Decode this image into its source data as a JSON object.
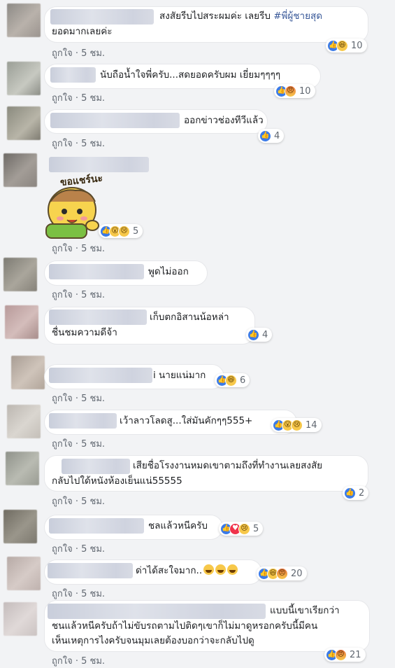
{
  "actions": {
    "like": "ถูกใจ",
    "sep": " · "
  },
  "comments": [
    {
      "text_lines": [
        "สงสัยรีบไปสระผมค่ะ เลยรีบ ",
        "ยอดมากเลยค่ะ"
      ],
      "hashtag": "#พี่ผู้ชายสุด",
      "time": "5 ชม.",
      "reactions": [
        "like",
        "haha"
      ],
      "count": "10"
    },
    {
      "text_lines": [
        "นับถือน้ำใจพี่ครับ...สดยอดครับผม เยี่ยมๆๆๆๆ"
      ],
      "time": "5 ชม.",
      "reactions": [
        "like",
        "angry"
      ],
      "count": "10"
    },
    {
      "text_lines": [
        "ออกข่าวช่องทีวีแล้ว"
      ],
      "time": "5 ชม.",
      "reactions": [
        "like"
      ],
      "count": "4"
    },
    {
      "sticker_text": "ขอแชร์นะ",
      "time": "5 ชม.",
      "reactions": [
        "like",
        "wow",
        "sad"
      ],
      "count": "5"
    },
    {
      "text_lines": [
        "พูดไม่ออก"
      ],
      "time": "5 ชม."
    },
    {
      "text_lines": [
        "เก็บตกอิสานน้อหล่า",
        "ชื่นชมความดีจ้า"
      ],
      "reactions": [
        "like"
      ],
      "count": "4"
    },
    {
      "text_lines": [
        "i นายแน่มาก"
      ],
      "time": "5 ชม.",
      "reactions": [
        "like",
        "haha"
      ],
      "count": "6"
    },
    {
      "text_lines": [
        "เว้าลาวโลดสู...ใส่มันคักๆๆ555+"
      ],
      "time": "5 ชม.",
      "reactions": [
        "like",
        "wow",
        "sad"
      ],
      "count": "14"
    },
    {
      "text_lines": [
        "เสียชื่อโรงงานหมดเขาตามถึงที่ทำงานเลยสงสัย",
        "กลับไปใด้หนังห้องเย็นแน่55555"
      ],
      "time": "5 ชม.",
      "reactions": [
        "like"
      ],
      "count": "2"
    },
    {
      "text_lines": [
        "ชลแล้วหนีครับ"
      ],
      "time": "5 ชม.",
      "reactions": [
        "like",
        "love",
        "sad"
      ],
      "count": "5"
    },
    {
      "text_lines": [
        "ด่าได้สะใจมาก.."
      ],
      "time": "5 ชม.",
      "reactions": [
        "like",
        "haha",
        "angry"
      ],
      "count": "20"
    },
    {
      "text_lines": [
        "แบบนี้เขาเรียกว่า",
        "ชนแล้วหนีครับถ้าไม่ขับรถตามไปติดๆเขาก็ไม่มาดูหรอกครับนี้มีคน",
        "เห็นเหตุการไงครับจนมุมเลยต้องบอกว่าจะกลับไปดู"
      ],
      "time": "5 ชม.",
      "reactions": [
        "like",
        "angry"
      ],
      "count": "21"
    }
  ]
}
